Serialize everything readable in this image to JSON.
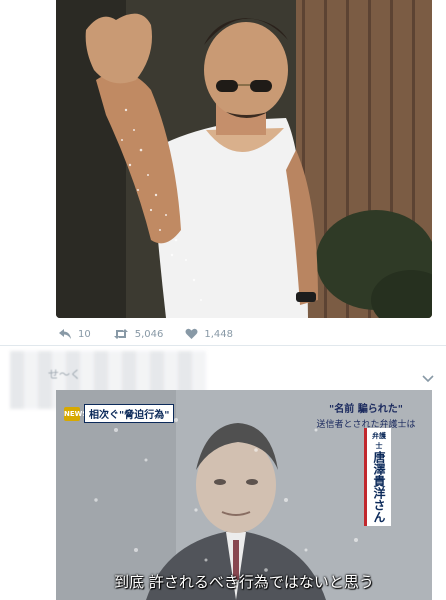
{
  "tweet1": {
    "actions": {
      "reply_count": "10",
      "retweet_count": "5,046",
      "like_count": "1,448"
    }
  },
  "tweet2": {
    "header_blurred_text": "せ〜く",
    "image": {
      "badge_text": "相次ぐ\"脅迫行為\"",
      "headline_line1": "\"名前 騙られた\"",
      "headline_line2": "送信者とされた弁護士は",
      "role": "弁護士",
      "name": "唐澤貴洋さん",
      "subtitle": "到底 許されるべき行為ではないと思う"
    }
  },
  "colors": {
    "icon_gray": "#8899a6",
    "divider": "#e1e8ed",
    "accent_red": "#c1272d"
  }
}
